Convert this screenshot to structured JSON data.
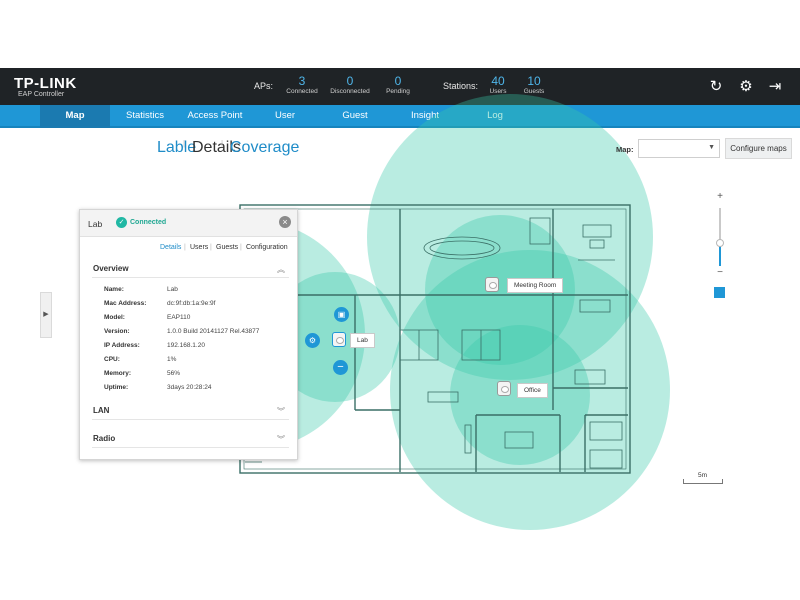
{
  "header": {
    "logo": "TP-LINK",
    "logo_sub": "EAP Controller",
    "aps_label": "APs:",
    "stations_label": "Stations:",
    "aps": [
      {
        "value": "3",
        "label": "Connected"
      },
      {
        "value": "0",
        "label": "Disconnected"
      },
      {
        "value": "0",
        "label": "Pending"
      }
    ],
    "stations": [
      {
        "value": "40",
        "label": "Users"
      },
      {
        "value": "10",
        "label": "Guests"
      }
    ],
    "buttons": {
      "refresh": "↻",
      "settings": "⚙",
      "logout": "⇥"
    }
  },
  "nav": {
    "items": [
      {
        "label": "Map",
        "active": true
      },
      {
        "label": "Statistics"
      },
      {
        "label": "Access Point"
      },
      {
        "label": "User"
      },
      {
        "label": "Guest"
      },
      {
        "label": "Insight"
      },
      {
        "label": "Log"
      }
    ]
  },
  "view_tabs": {
    "items": [
      {
        "label": "Lable",
        "active": true
      },
      {
        "label": "Details"
      },
      {
        "label": "Coverage",
        "active": true
      }
    ]
  },
  "map_select": {
    "label": "Map:",
    "value": "",
    "configure_button": "Configure maps"
  },
  "panel": {
    "title": "Lab",
    "status": "Connected",
    "tabs": [
      "Details",
      "Users",
      "Guests",
      "Configuration"
    ],
    "sections": {
      "overview": "Overview",
      "lan": "LAN",
      "radio": "Radio"
    },
    "rows": [
      {
        "key": "Name:",
        "value": "Lab"
      },
      {
        "key": "Mac Address:",
        "value": "dc:9f:db:1a:9e:9f"
      },
      {
        "key": "Model:",
        "value": "EAP110"
      },
      {
        "key": "Version:",
        "value": "1.0.0 Build 20141127 Rel.43877"
      },
      {
        "key": "IP Address:",
        "value": "192.168.1.20"
      },
      {
        "key": "CPU:",
        "value": "1%"
      },
      {
        "key": "Memory:",
        "value": "56%"
      },
      {
        "key": "Uptime:",
        "value": "3days 20:28:24"
      }
    ]
  },
  "access_points": [
    {
      "name": "Lab"
    },
    {
      "name": "Meeting Room"
    },
    {
      "name": "Office"
    }
  ],
  "scale": {
    "label": "5m"
  },
  "colors": {
    "topbar": "#1f2326",
    "nav": "#1f97d6",
    "accent": "#1f97d6",
    "coverage": "#37c9a9",
    "connected": "#21b8a4"
  },
  "icons": {
    "gear": "⚙",
    "lock": "🔒",
    "remove": "−",
    "expand": "▶"
  }
}
